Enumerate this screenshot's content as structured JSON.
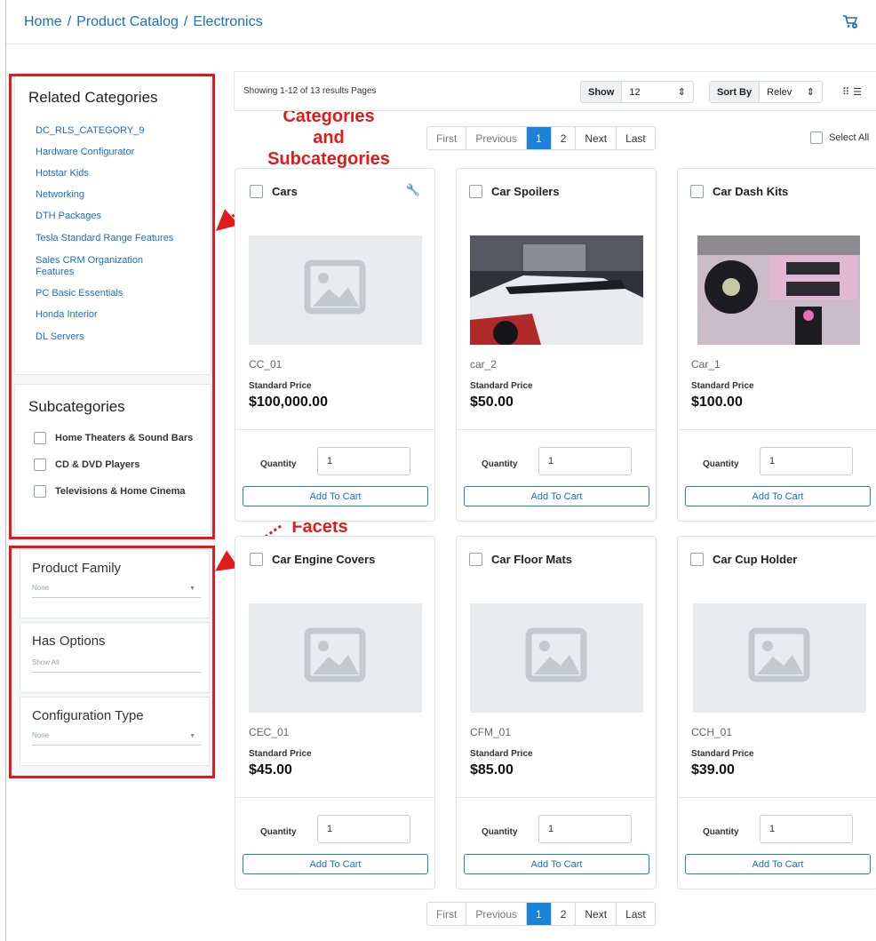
{
  "breadcrumb": {
    "home": "Home",
    "catalog": "Product Catalog",
    "current": "Electronics"
  },
  "related_categories": {
    "title": "Related Categories",
    "items": [
      "DC_RLS_CATEGORY_9",
      "Hardware Configurator",
      "Hotstar Kids",
      "Networking",
      "DTH Packages",
      "Tesla Standard Range Features",
      "Sales CRM Organization Features",
      "PC Basic Essentials",
      "Honda Interior",
      "DL Servers"
    ]
  },
  "subcategories": {
    "title": "Subcategories",
    "items": [
      "Home Theaters & Sound Bars",
      "CD & DVD Players",
      "Televisions & Home Cinema"
    ]
  },
  "facets": [
    {
      "title": "Product Family",
      "value": "None"
    },
    {
      "title": "Has Options",
      "value": "Show All"
    },
    {
      "title": "Configuration Type",
      "value": "None"
    }
  ],
  "annotations": {
    "categories": "Categories\nand\nSubcategories",
    "facets": "Facets"
  },
  "toolbar": {
    "showing": "Showing 1-12 of 13 results Pages",
    "show_label": "Show",
    "show_value": "12",
    "sort_label": "Sort By",
    "sort_value": "Relev"
  },
  "pager": {
    "first": "First",
    "previous": "Previous",
    "page1": "1",
    "page2": "2",
    "next": "Next",
    "last": "Last"
  },
  "select_all": "Select All",
  "product_common": {
    "std_price_label": "Standard Price",
    "quantity_label": "Quantity",
    "add_to_cart": "Add To Cart"
  },
  "products": [
    {
      "name": "Cars",
      "sku": "CC_01",
      "price": "$100,000.00",
      "qty": "1"
    },
    {
      "name": "Car Spoilers",
      "sku": "car_2",
      "price": "$50.00",
      "qty": "1"
    },
    {
      "name": "Car Dash Kits",
      "sku": "Car_1",
      "price": "$100.00",
      "qty": "1"
    },
    {
      "name": "Car Engine Covers",
      "sku": "CEC_01",
      "price": "$45.00",
      "qty": "1"
    },
    {
      "name": "Car Floor Mats",
      "sku": "CFM_01",
      "price": "$85.00",
      "qty": "1"
    },
    {
      "name": "Car Cup Holder",
      "sku": "CCH_01",
      "price": "$39.00",
      "qty": "1"
    }
  ],
  "colors": {
    "link": "#1a6fc2",
    "primary": "#1a82d9",
    "annotation": "#e01b1b"
  }
}
